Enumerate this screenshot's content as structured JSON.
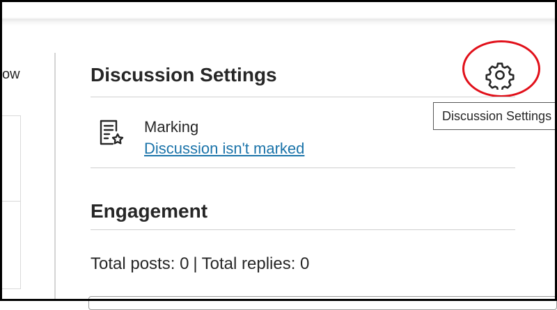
{
  "left_panel": {
    "partial_text": "ow"
  },
  "discussion_settings": {
    "title": "Discussion Settings",
    "gear_tooltip": "Discussion Settings",
    "marking": {
      "label": "Marking",
      "link": "Discussion isn't marked",
      "icon": "marking-rubric-star-icon"
    }
  },
  "engagement": {
    "title": "Engagement",
    "total_posts": "Total posts: 0",
    "separator": "|",
    "total_replies": "Total replies: 0"
  },
  "colors": {
    "link": "#1a73a9",
    "annotation_red": "#e1101a",
    "text": "#262626"
  }
}
